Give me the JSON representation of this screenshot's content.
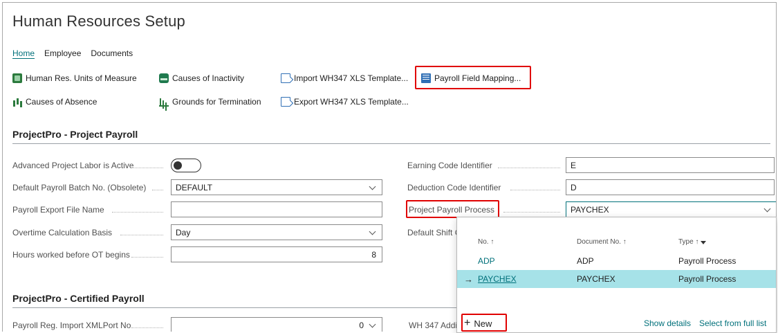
{
  "page": {
    "title": "Human Resources Setup"
  },
  "tabs": [
    {
      "label": "Home"
    },
    {
      "label": "Employee"
    },
    {
      "label": "Documents"
    }
  ],
  "actions": {
    "units": {
      "label": "Human Res. Units of Measure",
      "icon": "units-icon"
    },
    "inactivity": {
      "label": "Causes of Inactivity",
      "icon": "inactivity-icon"
    },
    "import_template": {
      "label": "Import WH347 XLS Template...",
      "icon": "import-document-icon"
    },
    "payroll_mapping": {
      "label": "Payroll Field Mapping...",
      "icon": "field-mapping-icon"
    },
    "absence": {
      "label": "Causes of Absence",
      "icon": "absence-icon"
    },
    "termination": {
      "label": "Grounds for Termination",
      "icon": "termination-icon"
    },
    "export_template": {
      "label": "Export WH347 XLS Template...",
      "icon": "export-document-icon"
    }
  },
  "project_payroll": {
    "title": "ProjectPro - Project Payroll",
    "advanced_labor": {
      "label": "Advanced Project Labor is Active",
      "value": false
    },
    "batch_no": {
      "label": "Default Payroll Batch No. (Obsolete)",
      "value": "DEFAULT"
    },
    "export_file": {
      "label": "Payroll Export File Name",
      "value": ""
    },
    "overtime_basis": {
      "label": "Overtime Calculation Basis",
      "value": "Day"
    },
    "hours_before_ot": {
      "label": "Hours worked before OT begins",
      "value": "8"
    },
    "earning_code": {
      "label": "Earning Code Identifier",
      "value": "E"
    },
    "deduction_code": {
      "label": "Deduction Code Identifier",
      "value": "D"
    },
    "payroll_process": {
      "label": "Project Payroll Process",
      "value": "PAYCHEX"
    },
    "default_shift": {
      "label": "Default Shift C"
    }
  },
  "certified_payroll": {
    "title": "ProjectPro - Certified Payroll",
    "xmlport": {
      "label": "Payroll Reg. Import XMLPort No",
      "value": "0"
    },
    "wh347": {
      "label": "WH 347 Addi"
    }
  },
  "lookup": {
    "headers": {
      "no": "No. ↑",
      "document_no": "Document No. ↑",
      "type": "Type ↑"
    },
    "rows": [
      {
        "no": "ADP",
        "document_no": "ADP",
        "type": "Payroll Process"
      },
      {
        "no": "PAYCHEX",
        "document_no": "PAYCHEX",
        "type": "Payroll Process"
      }
    ],
    "new_label": "New",
    "show_details": "Show details",
    "select_full": "Select from full list"
  },
  "colors": {
    "accent": "#00707a",
    "highlight_row": "#a6e2e8",
    "annotation": "#e00000"
  }
}
